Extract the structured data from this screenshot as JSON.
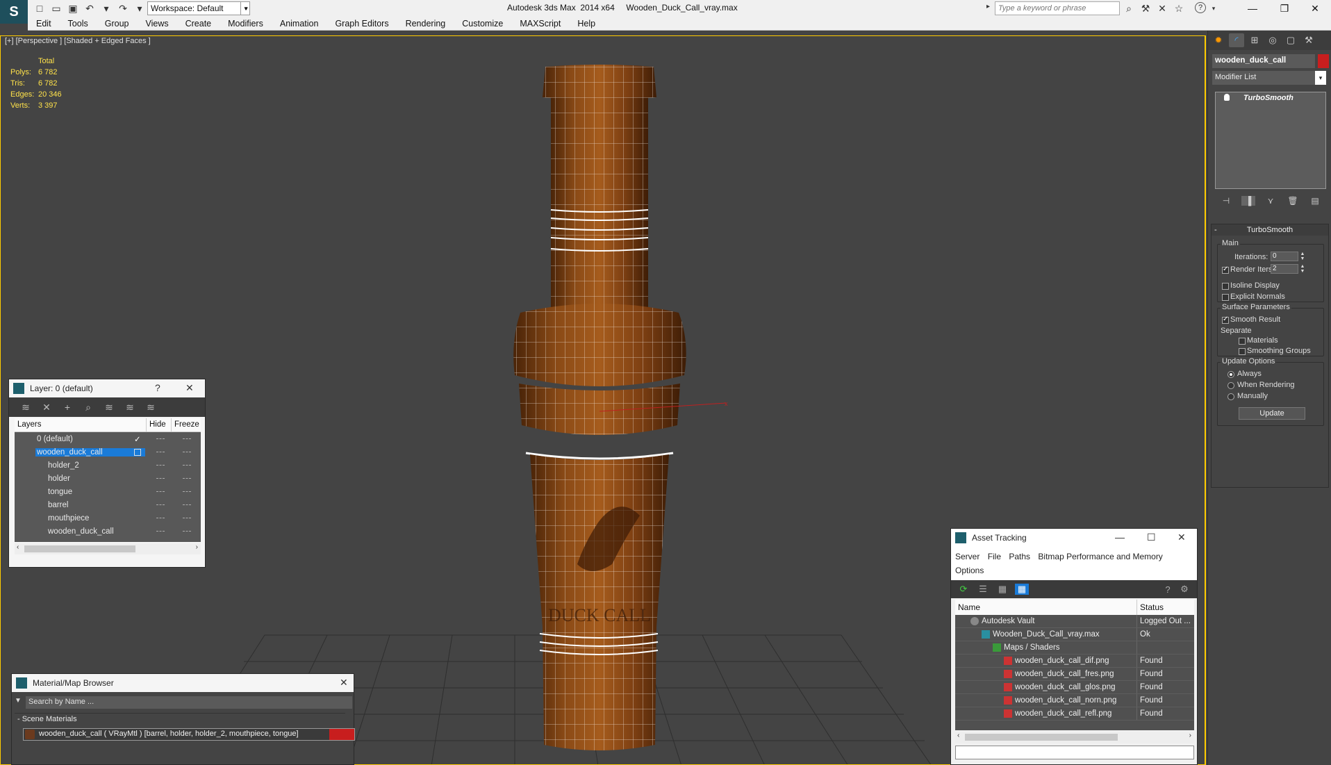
{
  "titlebar": {
    "workspace": "Workspace: Default",
    "app_title": "Autodesk 3ds Max  2014 x64     Wooden_Duck_Call_vray.max",
    "search_placeholder": "Type a keyword or phrase",
    "help_label": "?"
  },
  "menu": [
    "Edit",
    "Tools",
    "Group",
    "Views",
    "Create",
    "Modifiers",
    "Animation",
    "Graph Editors",
    "Rendering",
    "Customize",
    "MAXScript",
    "Help"
  ],
  "viewport": {
    "label": "[+] [Perspective ] [Shaded + Edged Faces ]",
    "stats": {
      "header": "Total",
      "rows": [
        {
          "k": "Polys:",
          "v": "6 782"
        },
        {
          "k": "Tris:",
          "v": "6 782"
        },
        {
          "k": "Edges:",
          "v": "20 346"
        },
        {
          "k": "Verts:",
          "v": "3 397"
        }
      ]
    },
    "texture_text": "DUCK CALL",
    "axis_label": "x"
  },
  "layer_explorer": {
    "title": "Layer: 0 (default)",
    "help": "?",
    "columns": [
      "Layers",
      "Hide",
      "Freeze"
    ],
    "rows": [
      {
        "name": "0 (default)",
        "level": 0,
        "selected": false,
        "active": true
      },
      {
        "name": "wooden_duck_call",
        "level": 0,
        "selected": true,
        "active": false
      },
      {
        "name": "holder_2",
        "level": 1,
        "selected": false,
        "active": false
      },
      {
        "name": "holder",
        "level": 1,
        "selected": false,
        "active": false
      },
      {
        "name": "tongue",
        "level": 1,
        "selected": false,
        "active": false
      },
      {
        "name": "barrel",
        "level": 1,
        "selected": false,
        "active": false
      },
      {
        "name": "mouthpiece",
        "level": 1,
        "selected": false,
        "active": false
      },
      {
        "name": "wooden_duck_call",
        "level": 1,
        "selected": false,
        "active": false
      }
    ]
  },
  "material_browser": {
    "title": "Material/Map Browser",
    "search_placeholder": "Search by Name ...",
    "group_label": "- Scene Materials",
    "material": "wooden_duck_call  ( VRayMtl )  [barrel, holder, holder_2, mouthpiece, tongue]"
  },
  "asset_tracking": {
    "title": "Asset Tracking",
    "menu": [
      "Server",
      "File",
      "Paths",
      "Bitmap Performance and Memory",
      "Options"
    ],
    "columns": [
      "Name",
      "Status"
    ],
    "rows": [
      {
        "name": "Autodesk Vault",
        "status": "Logged Out ...",
        "level": 1,
        "icon": "vault-icon"
      },
      {
        "name": "Wooden_Duck_Call_vray.max",
        "status": "Ok",
        "level": 2,
        "icon": "max-file-icon"
      },
      {
        "name": "Maps / Shaders",
        "status": "",
        "level": 3,
        "icon": "maps-folder-icon"
      },
      {
        "name": "wooden_duck_call_dif.png",
        "status": "Found",
        "level": 4,
        "icon": "png-icon"
      },
      {
        "name": "wooden_duck_call_fres.png",
        "status": "Found",
        "level": 4,
        "icon": "png-icon"
      },
      {
        "name": "wooden_duck_call_glos.png",
        "status": "Found",
        "level": 4,
        "icon": "png-icon"
      },
      {
        "name": "wooden_duck_call_norn.png",
        "status": "Found",
        "level": 4,
        "icon": "png-icon"
      },
      {
        "name": "wooden_duck_call_refl.png",
        "status": "Found",
        "level": 4,
        "icon": "png-icon"
      }
    ]
  },
  "command_panel": {
    "object_name": "wooden_duck_call",
    "object_color": "#c81e1e",
    "modifier_list": "Modifier List",
    "stack": [
      "TurboSmooth"
    ],
    "turbosmooth": {
      "title": "TurboSmooth",
      "main_label": "Main",
      "iterations_label": "Iterations:",
      "iterations_value": "0",
      "render_iters_label": "Render Iters:",
      "render_iters_value": "2",
      "render_iters_checked": true,
      "isoline_label": "Isoline Display",
      "explicit_normals_label": "Explicit Normals",
      "surface_params_label": "Surface Parameters",
      "smooth_result_label": "Smooth Result",
      "separate_label": "Separate",
      "materials_label": "Materials",
      "smoothing_groups_label": "Smoothing Groups",
      "update_options_label": "Update Options",
      "always_label": "Always",
      "when_rendering_label": "When Rendering",
      "manually_label": "Manually",
      "update_button": "Update"
    }
  },
  "colors": {
    "accent_selection": "#1a7bd8",
    "viewport_bg": "#444444",
    "wood": "#7a3f12",
    "wire": "#ffffff",
    "stats_text": "#ffe24a"
  }
}
